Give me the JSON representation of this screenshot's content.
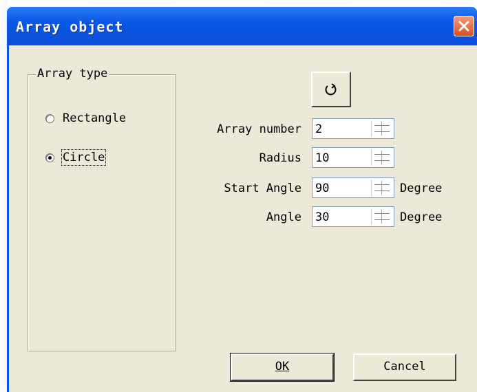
{
  "window": {
    "title": "Array object",
    "close_icon": "close-x-icon"
  },
  "array_type": {
    "legend": "Array type",
    "options": [
      {
        "label": "Rectangle",
        "checked": false
      },
      {
        "label": "Circle",
        "checked": true
      }
    ]
  },
  "toolbar": {
    "rotate_icon": "rotate-clockwise-icon"
  },
  "fields": {
    "array_number": {
      "label": "Array number",
      "value": "2"
    },
    "radius": {
      "label": "Radius",
      "value": "10"
    },
    "start_angle": {
      "label": "Start Angle",
      "value": "90",
      "unit": "Degree"
    },
    "angle": {
      "label": "Angle",
      "value": "30",
      "unit": "Degree"
    }
  },
  "buttons": {
    "ok": "OK",
    "cancel": "Cancel"
  },
  "colors": {
    "titlebar": "#0A53E3",
    "dialog_bg": "#ECE9D8",
    "close_button": "#DB4E22"
  }
}
